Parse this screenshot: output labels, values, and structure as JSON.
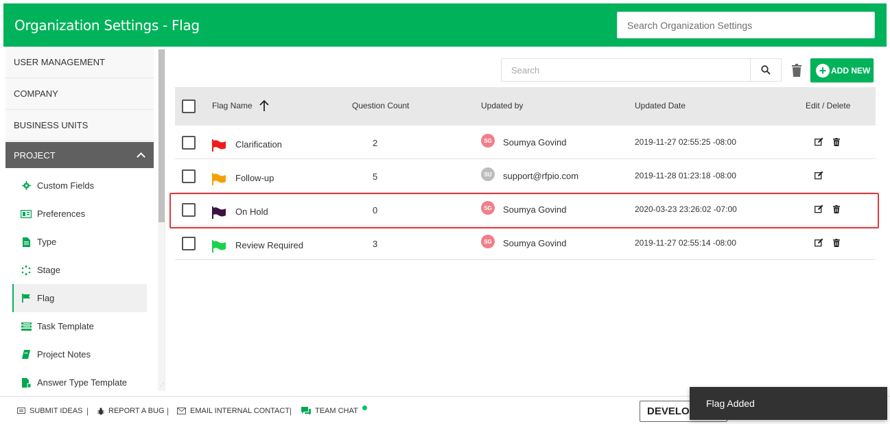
{
  "header": {
    "title": "Organization Settings - Flag",
    "search_placeholder": "Search Organization Settings"
  },
  "sidebar": {
    "categories": [
      {
        "label": "USER MANAGEMENT"
      },
      {
        "label": "COMPANY"
      },
      {
        "label": "BUSINESS UNITS"
      },
      {
        "label": "PROJECT"
      }
    ],
    "items": [
      {
        "label": "Custom Fields",
        "icon": "gear-icon"
      },
      {
        "label": "Preferences",
        "icon": "preferences-icon"
      },
      {
        "label": "Type",
        "icon": "document-icon"
      },
      {
        "label": "Stage",
        "icon": "stage-icon"
      },
      {
        "label": "Flag",
        "icon": "flag-icon",
        "active": true
      },
      {
        "label": "Task Template",
        "icon": "task-template-icon"
      },
      {
        "label": "Project Notes",
        "icon": "notes-icon"
      },
      {
        "label": "Answer Type Template",
        "icon": "answer-template-icon"
      }
    ]
  },
  "toolbar": {
    "search_placeholder": "Search",
    "add_label": "ADD NEW"
  },
  "table": {
    "columns": [
      "Flag Name",
      "Question Count",
      "Updated by",
      "Updated Date",
      "Edit / Delete"
    ],
    "rows": [
      {
        "name": "Clarification",
        "flag_color": "#ee1c1c",
        "count": "2",
        "initials": "SG",
        "avatar_color": "#f07f8a",
        "updated_by": "Soumya Govind",
        "date": "2019-11-27 02:55:25 -08:00",
        "deletable": true
      },
      {
        "name": "Follow-up",
        "flag_color": "#f5a000",
        "count": "5",
        "initials": "SU",
        "avatar_color": "#bdbdbd",
        "updated_by": "support@rfpio.com",
        "date": "2019-11-28 01:23:18 -08:00",
        "deletable": false
      },
      {
        "name": "On Hold",
        "flag_color": "#3a1340",
        "count": "0",
        "initials": "SG",
        "avatar_color": "#f07f8a",
        "updated_by": "Soumya Govind",
        "date": "2020-03-23 23:26:02 -07:00",
        "deletable": true
      },
      {
        "name": "Review Required",
        "flag_color": "#19d24a",
        "count": "3",
        "initials": "SG",
        "avatar_color": "#f07f8a",
        "updated_by": "Soumya Govind",
        "date": "2019-11-27 02:55:14 -08:00",
        "deletable": true
      }
    ]
  },
  "footer": {
    "submit_ideas": "SUBMIT IDEAS",
    "report_bug": "REPORT A BUG",
    "email_contact": "EMAIL INTERNAL CONTACT",
    "team_chat": "TEAM CHAT",
    "separator": "|",
    "dev_label": "DEVELOP"
  },
  "toast": {
    "message": "Flag Added"
  },
  "colors": {
    "brand": "#00b25a",
    "highlight": "#e0393e"
  }
}
